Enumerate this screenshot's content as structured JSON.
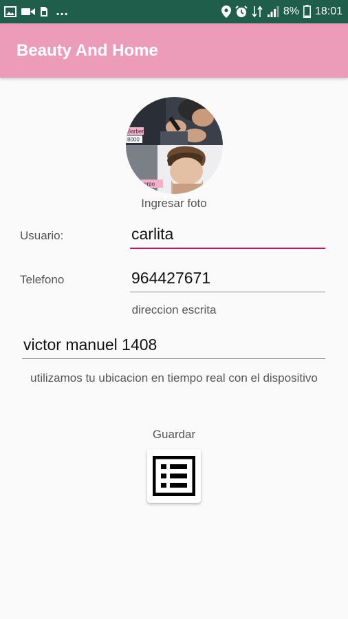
{
  "status_bar": {
    "left_icons": [
      "image-icon",
      "video-camera-icon",
      "sim-icon"
    ],
    "more": "...",
    "battery_percent": "8%",
    "time": "18:01"
  },
  "app_bar": {
    "title": "Beauty And Home"
  },
  "profile": {
    "photo_caption": "Ingresar foto",
    "photo_tag_top": "Barber",
    "photo_tag_num": "8000",
    "photo_tag_bottom": "erpo"
  },
  "form": {
    "usuario_label": "Usuario:",
    "usuario_value": "carlita",
    "telefono_label": "Telefono",
    "telefono_value": "964427671",
    "direccion_label": "direccion escrita",
    "direccion_value": "victor manuel 1408",
    "location_info": "utilizamos tu ubicacion en tiempo real con el dispositivo"
  },
  "actions": {
    "save_label": "Guardar",
    "save_icon": "list-icon"
  },
  "colors": {
    "status_bar": "#1f5e4a",
    "app_bar": "#ec9cb8",
    "accent": "#c2185b"
  }
}
